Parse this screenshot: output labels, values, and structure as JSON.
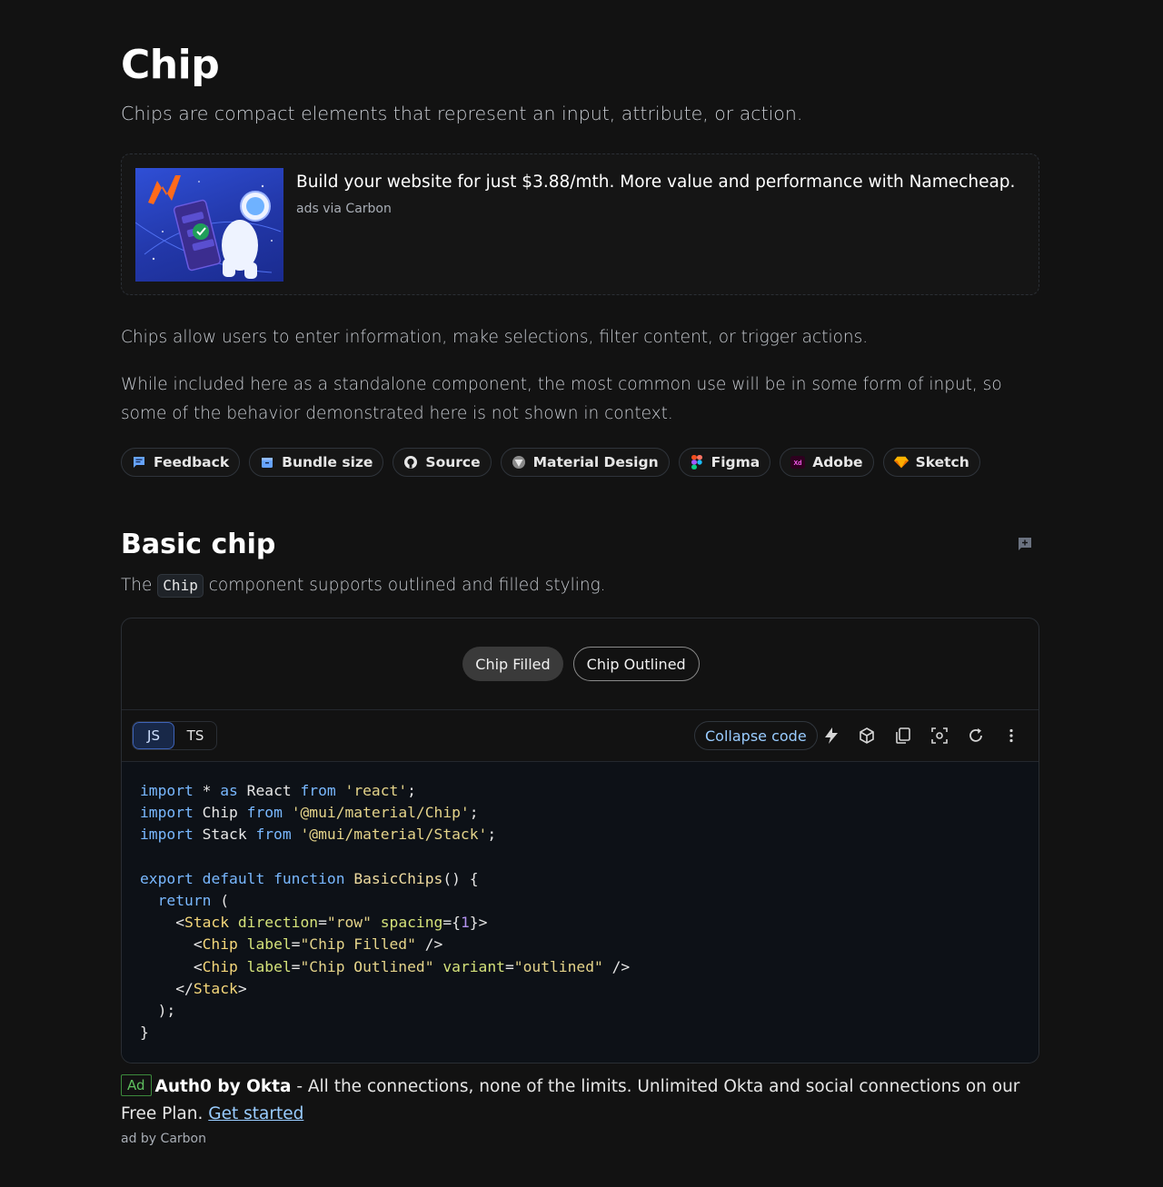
{
  "page": {
    "title": "Chip",
    "subtitle": "Chips are compact elements that represent an input, attribute, or action."
  },
  "top_ad": {
    "text": "Build your website for just $3.88/mth. More value and performance with Namecheap.",
    "source": "ads via Carbon"
  },
  "intro": {
    "p1": "Chips allow users to enter information, make selections, filter content, or trigger actions.",
    "p2": "While included here as a standalone component, the most common use will be in some form of input, so some of the behavior demonstrated here is not shown in context."
  },
  "resources": [
    {
      "label": "Feedback",
      "icon": "feedback-icon"
    },
    {
      "label": "Bundle size",
      "icon": "bundle-icon"
    },
    {
      "label": "Source",
      "icon": "github-icon"
    },
    {
      "label": "Material Design",
      "icon": "material-icon"
    },
    {
      "label": "Figma",
      "icon": "figma-icon"
    },
    {
      "label": "Adobe",
      "icon": "adobe-xd-icon"
    },
    {
      "label": "Sketch",
      "icon": "sketch-icon"
    }
  ],
  "section": {
    "title": "Basic chip",
    "desc_before": "The ",
    "desc_code": "Chip",
    "desc_after": " component supports outlined and filled styling."
  },
  "demo": {
    "chip_filled": "Chip Filled",
    "chip_outlined": "Chip Outlined",
    "lang_js": "JS",
    "lang_ts": "TS",
    "collapse_label": "Collapse code"
  },
  "bottom_ad": {
    "badge": "Ad",
    "brand": "Auth0 by Okta",
    "text": " - All the connections, none of the limits. Unlimited Okta and social connections on our Free Plan. ",
    "link": "Get started",
    "source": "ad by Carbon"
  },
  "colors": {
    "background": "#121212",
    "code_background": "#0d1117",
    "link": "#99ccff",
    "active_lang": "#182848"
  }
}
